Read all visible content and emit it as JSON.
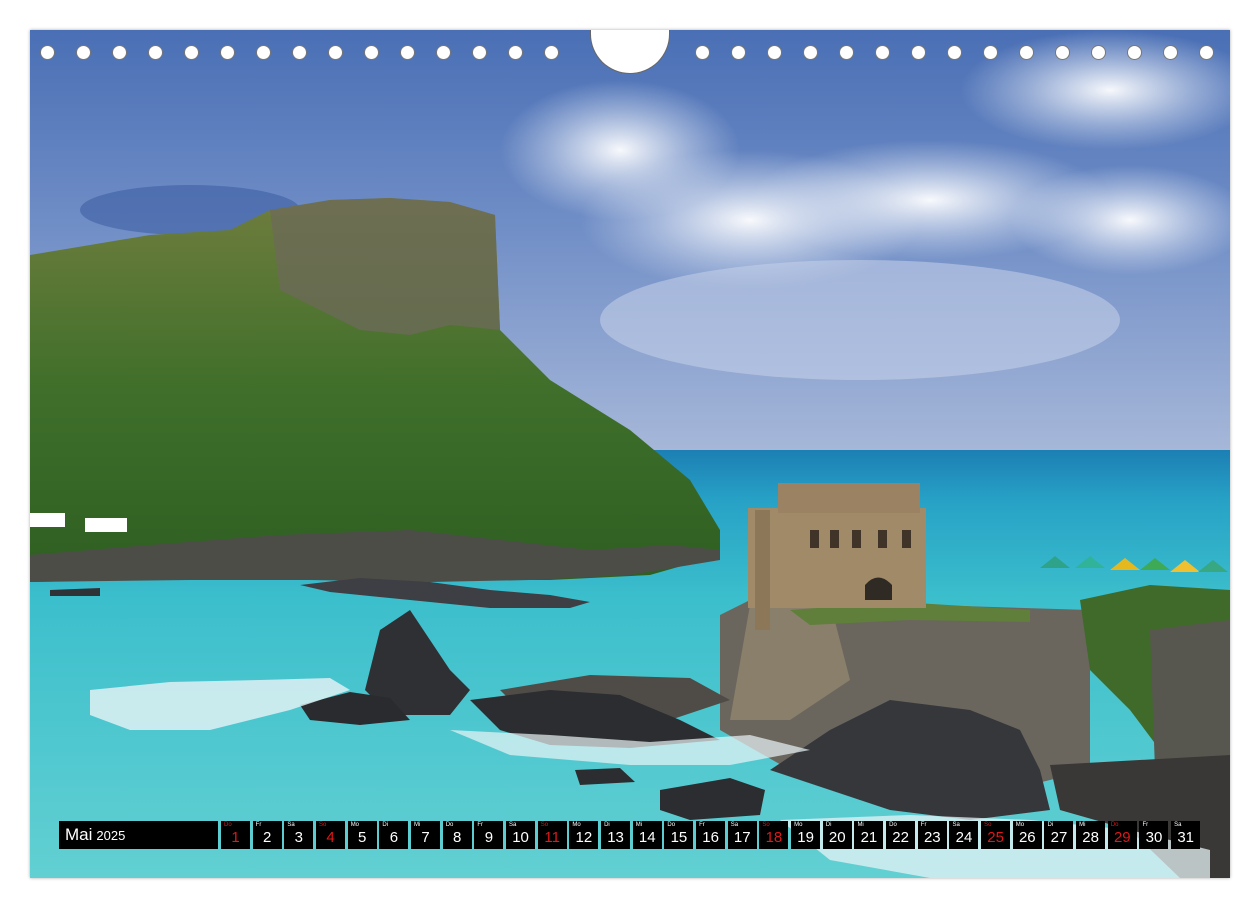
{
  "calendar": {
    "month": "Mai",
    "year": "2025",
    "days": [
      {
        "wd": "Do",
        "num": "1",
        "holiday": true
      },
      {
        "wd": "Fr",
        "num": "2",
        "holiday": false
      },
      {
        "wd": "Sa",
        "num": "3",
        "holiday": false
      },
      {
        "wd": "So",
        "num": "4",
        "holiday": true
      },
      {
        "wd": "Mo",
        "num": "5",
        "holiday": false
      },
      {
        "wd": "Di",
        "num": "6",
        "holiday": false
      },
      {
        "wd": "Mi",
        "num": "7",
        "holiday": false
      },
      {
        "wd": "Do",
        "num": "8",
        "holiday": false
      },
      {
        "wd": "Fr",
        "num": "9",
        "holiday": false
      },
      {
        "wd": "Sa",
        "num": "10",
        "holiday": false
      },
      {
        "wd": "So",
        "num": "11",
        "holiday": true
      },
      {
        "wd": "Mo",
        "num": "12",
        "holiday": false
      },
      {
        "wd": "Di",
        "num": "13",
        "holiday": false
      },
      {
        "wd": "Mi",
        "num": "14",
        "holiday": false
      },
      {
        "wd": "Do",
        "num": "15",
        "holiday": false
      },
      {
        "wd": "Fr",
        "num": "16",
        "holiday": false
      },
      {
        "wd": "Sa",
        "num": "17",
        "holiday": false
      },
      {
        "wd": "So",
        "num": "18",
        "holiday": true
      },
      {
        "wd": "Mo",
        "num": "19",
        "holiday": false
      },
      {
        "wd": "Di",
        "num": "20",
        "holiday": false
      },
      {
        "wd": "Mi",
        "num": "21",
        "holiday": false
      },
      {
        "wd": "Do",
        "num": "22",
        "holiday": false
      },
      {
        "wd": "Fr",
        "num": "23",
        "holiday": false
      },
      {
        "wd": "Sa",
        "num": "24",
        "holiday": false
      },
      {
        "wd": "So",
        "num": "25",
        "holiday": true
      },
      {
        "wd": "Mo",
        "num": "26",
        "holiday": false
      },
      {
        "wd": "Di",
        "num": "27",
        "holiday": false
      },
      {
        "wd": "Mi",
        "num": "28",
        "holiday": false
      },
      {
        "wd": "Do",
        "num": "29",
        "holiday": true
      },
      {
        "wd": "Fr",
        "num": "30",
        "holiday": false
      },
      {
        "wd": "Sa",
        "num": "31",
        "holiday": false
      }
    ]
  },
  "colors": {
    "bar": "#000000",
    "text": "#ffffff",
    "holiday": "#e01818"
  }
}
